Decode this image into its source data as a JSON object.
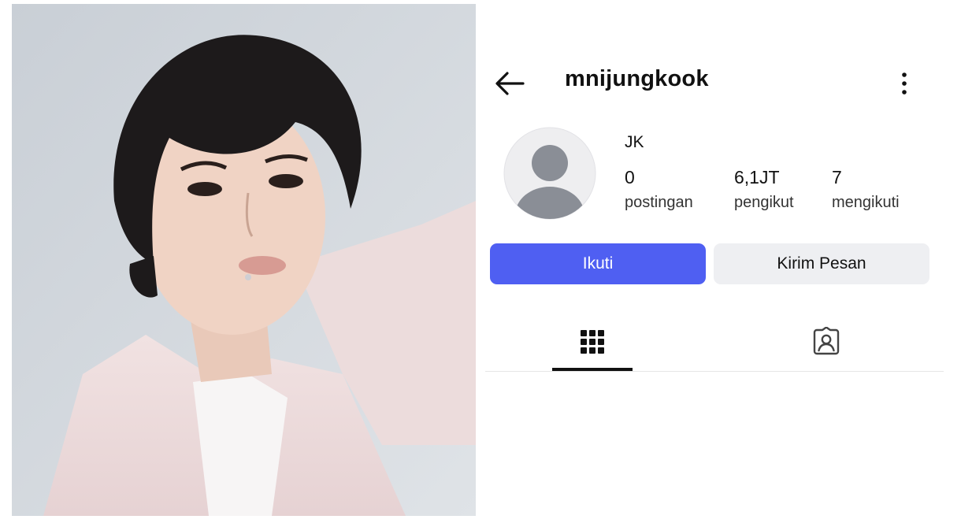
{
  "profile": {
    "username": "mnijungkook",
    "display_name": "JK",
    "stats": [
      {
        "value": "0",
        "label": "postingan"
      },
      {
        "value": "6,1JT",
        "label": "pengikut"
      },
      {
        "value": "7",
        "label": "mengikuti"
      }
    ]
  },
  "actions": {
    "follow_label": "Ikuti",
    "message_label": "Kirim Pesan"
  },
  "icons": {
    "back": "arrow-left-icon",
    "more": "more-vertical-icon",
    "avatar": "default-avatar-icon",
    "grid_tab": "grid-icon",
    "tagged_tab": "tagged-person-icon"
  },
  "colors": {
    "follow_button": "#4f5ff2",
    "message_button": "#eeeff2",
    "avatar_bg": "#eeeef0",
    "avatar_figure": "#8a8e96"
  }
}
